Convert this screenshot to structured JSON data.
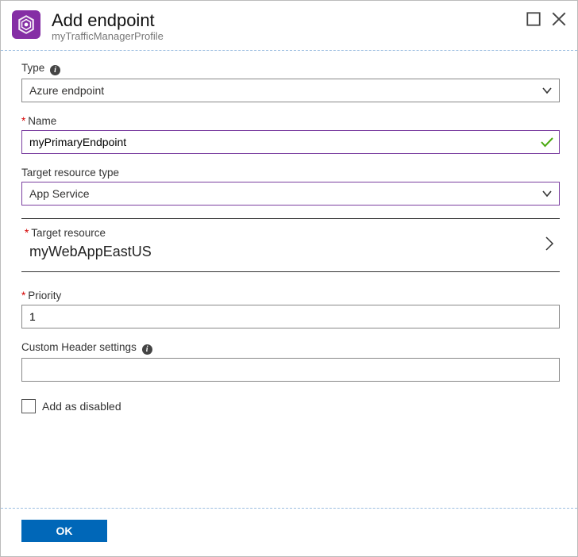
{
  "header": {
    "title": "Add endpoint",
    "subtitle": "myTrafficManagerProfile"
  },
  "form": {
    "type": {
      "label": "Type",
      "value": "Azure endpoint"
    },
    "name": {
      "label": "Name",
      "value": "myPrimaryEndpoint",
      "required": true,
      "valid": true
    },
    "targetResourceType": {
      "label": "Target resource type",
      "value": "App Service"
    },
    "targetResource": {
      "label": "Target resource",
      "value": "myWebAppEastUS",
      "required": true
    },
    "priority": {
      "label": "Priority",
      "value": "1",
      "required": true
    },
    "customHeader": {
      "label": "Custom Header settings",
      "value": ""
    },
    "addDisabled": {
      "label": "Add as disabled",
      "checked": false
    }
  },
  "footer": {
    "ok": "OK"
  }
}
